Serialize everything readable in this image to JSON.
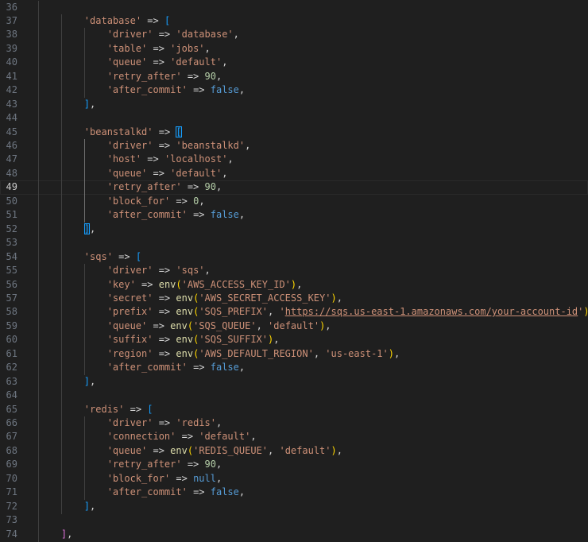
{
  "editor": {
    "active_line": 49,
    "colors": {
      "background": "#1f1f1f",
      "string": "#ce9178",
      "number": "#b5cea8",
      "keyword": "#569cd6",
      "function": "#dcdcaa",
      "bracket_outer": "#da70d6",
      "bracket_inner": "#179fff",
      "paren": "#ffd700"
    },
    "lines": [
      {
        "n": "36",
        "indent": 0,
        "tokens": []
      },
      {
        "n": "37",
        "indent": 2,
        "tokens": [
          [
            "str",
            "'database'"
          ],
          [
            "op",
            " => "
          ],
          [
            "b2",
            "["
          ]
        ]
      },
      {
        "n": "38",
        "indent": 3,
        "tokens": [
          [
            "str",
            "'driver'"
          ],
          [
            "op",
            " => "
          ],
          [
            "str",
            "'database'"
          ],
          [
            "op",
            ","
          ]
        ]
      },
      {
        "n": "39",
        "indent": 3,
        "tokens": [
          [
            "str",
            "'table'"
          ],
          [
            "op",
            " => "
          ],
          [
            "str",
            "'jobs'"
          ],
          [
            "op",
            ","
          ]
        ]
      },
      {
        "n": "40",
        "indent": 3,
        "tokens": [
          [
            "str",
            "'queue'"
          ],
          [
            "op",
            " => "
          ],
          [
            "str",
            "'default'"
          ],
          [
            "op",
            ","
          ]
        ]
      },
      {
        "n": "41",
        "indent": 3,
        "tokens": [
          [
            "str",
            "'retry_after'"
          ],
          [
            "op",
            " => "
          ],
          [
            "num",
            "90"
          ],
          [
            "op",
            ","
          ]
        ]
      },
      {
        "n": "42",
        "indent": 3,
        "tokens": [
          [
            "str",
            "'after_commit'"
          ],
          [
            "op",
            " => "
          ],
          [
            "kw",
            "false"
          ],
          [
            "op",
            ","
          ]
        ]
      },
      {
        "n": "43",
        "indent": 2,
        "tokens": [
          [
            "b2",
            "]"
          ],
          [
            "op",
            ","
          ]
        ]
      },
      {
        "n": "44",
        "indent": 0,
        "tokens": []
      },
      {
        "n": "45",
        "indent": 2,
        "tokens": [
          [
            "str",
            "'beanstalkd'"
          ],
          [
            "op",
            " => "
          ],
          [
            "b2 t-match",
            "["
          ]
        ]
      },
      {
        "n": "46",
        "indent": 3,
        "tokens": [
          [
            "str",
            "'driver'"
          ],
          [
            "op",
            " => "
          ],
          [
            "str",
            "'beanstalkd'"
          ],
          [
            "op",
            ","
          ]
        ]
      },
      {
        "n": "47",
        "indent": 3,
        "tokens": [
          [
            "str",
            "'host'"
          ],
          [
            "op",
            " => "
          ],
          [
            "str",
            "'localhost'"
          ],
          [
            "op",
            ","
          ]
        ]
      },
      {
        "n": "48",
        "indent": 3,
        "tokens": [
          [
            "str",
            "'queue'"
          ],
          [
            "op",
            " => "
          ],
          [
            "str",
            "'default'"
          ],
          [
            "op",
            ","
          ]
        ]
      },
      {
        "n": "49",
        "indent": 3,
        "tokens": [
          [
            "str",
            "'retry_after'"
          ],
          [
            "op",
            " => "
          ],
          [
            "num",
            "90"
          ],
          [
            "op",
            ","
          ]
        ]
      },
      {
        "n": "50",
        "indent": 3,
        "tokens": [
          [
            "str",
            "'block_for'"
          ],
          [
            "op",
            " => "
          ],
          [
            "num",
            "0"
          ],
          [
            "op",
            ","
          ]
        ]
      },
      {
        "n": "51",
        "indent": 3,
        "tokens": [
          [
            "str",
            "'after_commit'"
          ],
          [
            "op",
            " => "
          ],
          [
            "kw",
            "false"
          ],
          [
            "op",
            ","
          ]
        ]
      },
      {
        "n": "52",
        "indent": 2,
        "tokens": [
          [
            "b2 t-match",
            "]"
          ],
          [
            "op",
            ","
          ]
        ]
      },
      {
        "n": "53",
        "indent": 0,
        "tokens": []
      },
      {
        "n": "54",
        "indent": 2,
        "tokens": [
          [
            "str",
            "'sqs'"
          ],
          [
            "op",
            " => "
          ],
          [
            "b2",
            "["
          ]
        ]
      },
      {
        "n": "55",
        "indent": 3,
        "tokens": [
          [
            "str",
            "'driver'"
          ],
          [
            "op",
            " => "
          ],
          [
            "str",
            "'sqs'"
          ],
          [
            "op",
            ","
          ]
        ]
      },
      {
        "n": "56",
        "indent": 3,
        "tokens": [
          [
            "str",
            "'key'"
          ],
          [
            "op",
            " => "
          ],
          [
            "fn",
            "env"
          ],
          [
            "p",
            "("
          ],
          [
            "str",
            "'AWS_ACCESS_KEY_ID'"
          ],
          [
            "p",
            ")"
          ],
          [
            "op",
            ","
          ]
        ]
      },
      {
        "n": "57",
        "indent": 3,
        "tokens": [
          [
            "str",
            "'secret'"
          ],
          [
            "op",
            " => "
          ],
          [
            "fn",
            "env"
          ],
          [
            "p",
            "("
          ],
          [
            "str",
            "'AWS_SECRET_ACCESS_KEY'"
          ],
          [
            "p",
            ")"
          ],
          [
            "op",
            ","
          ]
        ]
      },
      {
        "n": "58",
        "indent": 3,
        "tokens": [
          [
            "str",
            "'prefix'"
          ],
          [
            "op",
            " => "
          ],
          [
            "fn",
            "env"
          ],
          [
            "p",
            "("
          ],
          [
            "str",
            "'SQS_PREFIX'"
          ],
          [
            "op",
            ", "
          ],
          [
            "str",
            "'"
          ],
          [
            "link",
            "https://sqs.us-east-1.amazonaws.com/your-account-id"
          ],
          [
            "str",
            "'"
          ],
          [
            "p",
            ")"
          ],
          [
            "op",
            ","
          ]
        ]
      },
      {
        "n": "59",
        "indent": 3,
        "tokens": [
          [
            "str",
            "'queue'"
          ],
          [
            "op",
            " => "
          ],
          [
            "fn",
            "env"
          ],
          [
            "p",
            "("
          ],
          [
            "str",
            "'SQS_QUEUE'"
          ],
          [
            "op",
            ", "
          ],
          [
            "str",
            "'default'"
          ],
          [
            "p",
            ")"
          ],
          [
            "op",
            ","
          ]
        ]
      },
      {
        "n": "60",
        "indent": 3,
        "tokens": [
          [
            "str",
            "'suffix'"
          ],
          [
            "op",
            " => "
          ],
          [
            "fn",
            "env"
          ],
          [
            "p",
            "("
          ],
          [
            "str",
            "'SQS_SUFFIX'"
          ],
          [
            "p",
            ")"
          ],
          [
            "op",
            ","
          ]
        ]
      },
      {
        "n": "61",
        "indent": 3,
        "tokens": [
          [
            "str",
            "'region'"
          ],
          [
            "op",
            " => "
          ],
          [
            "fn",
            "env"
          ],
          [
            "p",
            "("
          ],
          [
            "str",
            "'AWS_DEFAULT_REGION'"
          ],
          [
            "op",
            ", "
          ],
          [
            "str",
            "'us-east-1'"
          ],
          [
            "p",
            ")"
          ],
          [
            "op",
            ","
          ]
        ]
      },
      {
        "n": "62",
        "indent": 3,
        "tokens": [
          [
            "str",
            "'after_commit'"
          ],
          [
            "op",
            " => "
          ],
          [
            "kw",
            "false"
          ],
          [
            "op",
            ","
          ]
        ]
      },
      {
        "n": "63",
        "indent": 2,
        "tokens": [
          [
            "b2",
            "]"
          ],
          [
            "op",
            ","
          ]
        ]
      },
      {
        "n": "64",
        "indent": 0,
        "tokens": []
      },
      {
        "n": "65",
        "indent": 2,
        "tokens": [
          [
            "str",
            "'redis'"
          ],
          [
            "op",
            " => "
          ],
          [
            "b2",
            "["
          ]
        ]
      },
      {
        "n": "66",
        "indent": 3,
        "tokens": [
          [
            "str",
            "'driver'"
          ],
          [
            "op",
            " => "
          ],
          [
            "str",
            "'redis'"
          ],
          [
            "op",
            ","
          ]
        ]
      },
      {
        "n": "67",
        "indent": 3,
        "tokens": [
          [
            "str",
            "'connection'"
          ],
          [
            "op",
            " => "
          ],
          [
            "str",
            "'default'"
          ],
          [
            "op",
            ","
          ]
        ]
      },
      {
        "n": "68",
        "indent": 3,
        "tokens": [
          [
            "str",
            "'queue'"
          ],
          [
            "op",
            " => "
          ],
          [
            "fn",
            "env"
          ],
          [
            "p",
            "("
          ],
          [
            "str",
            "'REDIS_QUEUE'"
          ],
          [
            "op",
            ", "
          ],
          [
            "str",
            "'default'"
          ],
          [
            "p",
            ")"
          ],
          [
            "op",
            ","
          ]
        ]
      },
      {
        "n": "69",
        "indent": 3,
        "tokens": [
          [
            "str",
            "'retry_after'"
          ],
          [
            "op",
            " => "
          ],
          [
            "num",
            "90"
          ],
          [
            "op",
            ","
          ]
        ]
      },
      {
        "n": "70",
        "indent": 3,
        "tokens": [
          [
            "str",
            "'block_for'"
          ],
          [
            "op",
            " => "
          ],
          [
            "kw",
            "null"
          ],
          [
            "op",
            ","
          ]
        ]
      },
      {
        "n": "71",
        "indent": 3,
        "tokens": [
          [
            "str",
            "'after_commit'"
          ],
          [
            "op",
            " => "
          ],
          [
            "kw",
            "false"
          ],
          [
            "op",
            ","
          ]
        ]
      },
      {
        "n": "72",
        "indent": 2,
        "tokens": [
          [
            "b2",
            "]"
          ],
          [
            "op",
            ","
          ]
        ]
      },
      {
        "n": "73",
        "indent": 0,
        "tokens": []
      },
      {
        "n": "74",
        "indent": 1,
        "tokens": [
          [
            "b1",
            "]"
          ],
          [
            "op",
            ","
          ]
        ]
      }
    ]
  }
}
